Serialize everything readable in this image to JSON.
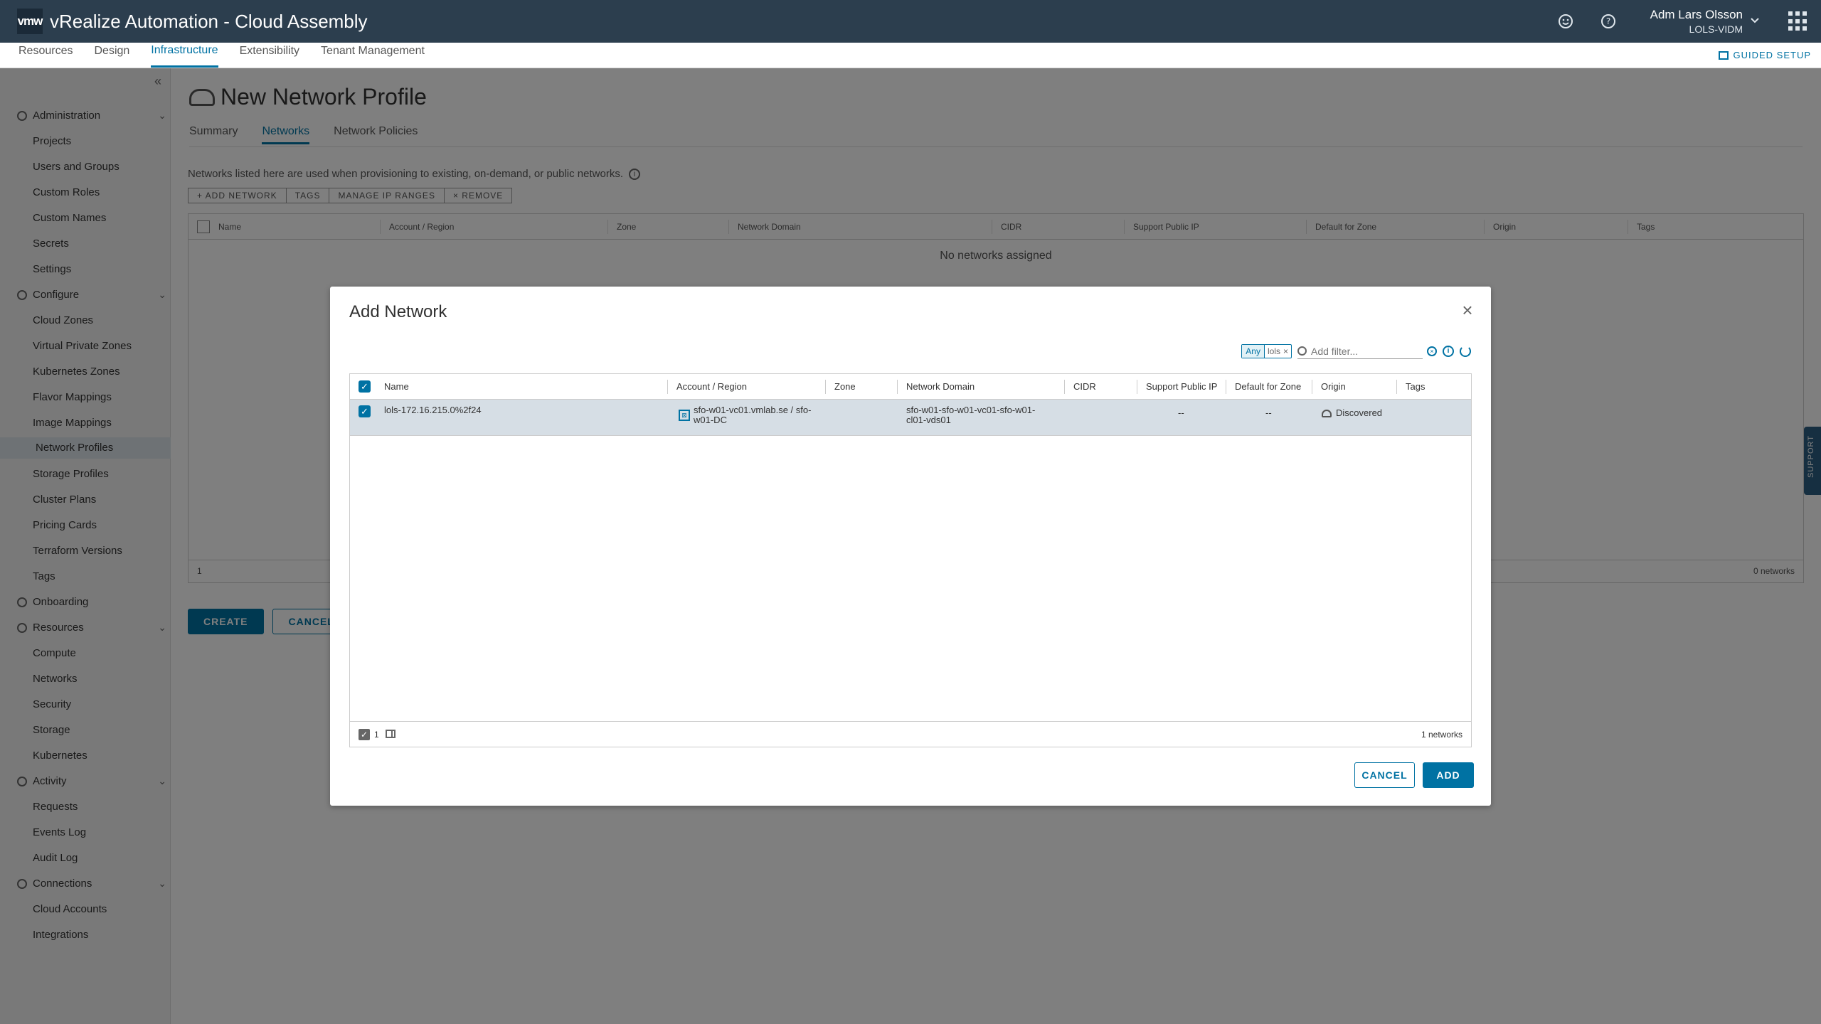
{
  "header": {
    "logo": "vmw",
    "title": "vRealize Automation - Cloud Assembly",
    "user_name": "Adm Lars Olsson",
    "user_org": "LOLS-VIDM",
    "icons": [
      "feedback-smiley-icon",
      "help-icon",
      "chevron-down-icon",
      "apps-grid-icon"
    ]
  },
  "nav": {
    "tabs": [
      "Resources",
      "Design",
      "Infrastructure",
      "Extensibility",
      "Tenant Management"
    ],
    "active": "Infrastructure",
    "guided_setup": "GUIDED SETUP"
  },
  "sidebar": {
    "sections": [
      {
        "label": "Administration",
        "items": [
          "Projects",
          "Users and Groups",
          "Custom Roles",
          "Custom Names",
          "Secrets",
          "Settings"
        ]
      },
      {
        "label": "Configure",
        "items": [
          "Cloud Zones",
          "Virtual Private Zones",
          "Kubernetes Zones",
          "Flavor Mappings",
          "Image Mappings",
          "Network Profiles",
          "Storage Profiles",
          "Cluster Plans",
          "Pricing Cards",
          "Terraform Versions",
          "Tags"
        ]
      },
      {
        "label": "Onboarding",
        "items": []
      },
      {
        "label": "Resources",
        "items": [
          "Compute",
          "Networks",
          "Security",
          "Storage",
          "Kubernetes"
        ]
      },
      {
        "label": "Activity",
        "items": [
          "Requests",
          "Events Log",
          "Audit Log"
        ]
      },
      {
        "label": "Connections",
        "items": [
          "Cloud Accounts",
          "Integrations"
        ]
      }
    ],
    "active_item": "Network Profiles"
  },
  "page": {
    "title": "New Network Profile",
    "tabs": [
      "Summary",
      "Networks",
      "Network Policies"
    ],
    "active_tab": "Networks",
    "description": "Networks listed here are used when provisioning to existing, on-demand, or public networks.",
    "toolbar": [
      "+ ADD NETWORK",
      "TAGS",
      "MANAGE IP RANGES",
      "× REMOVE"
    ],
    "columns": [
      "Name",
      "Account / Region",
      "Zone",
      "Network Domain",
      "CIDR",
      "Support Public IP",
      "Default for Zone",
      "Origin",
      "Tags"
    ],
    "empty": "No networks assigned",
    "footer_selected": "1",
    "footer_count": "0 networks",
    "create": "CREATE",
    "cancel": "CANCEL"
  },
  "support_tab": "SUPPORT",
  "modal": {
    "title": "Add Network",
    "filter": {
      "chip_key": "Any",
      "chip_value": "lols",
      "placeholder": "Add filter..."
    },
    "columns": [
      "Name",
      "Account / Region",
      "Zone",
      "Network Domain",
      "CIDR",
      "Support Public IP",
      "Default for Zone",
      "Origin",
      "Tags"
    ],
    "rows": [
      {
        "name": "lols-172.16.215.0%2f24",
        "account_line1": "sfo-w01-vc01.vmlab.se / sfo-",
        "account_line2": "w01-DC",
        "zone": "",
        "domain_line1": "sfo-w01-sfo-w01-vc01-sfo-w01-",
        "domain_line2": "cl01-vds01",
        "cidr": "",
        "public_ip": "--",
        "default_zone": "--",
        "origin": "Discovered",
        "tags": ""
      }
    ],
    "footer_selected": "1",
    "footer_count": "1 networks",
    "cancel": "CANCEL",
    "add": "ADD"
  }
}
